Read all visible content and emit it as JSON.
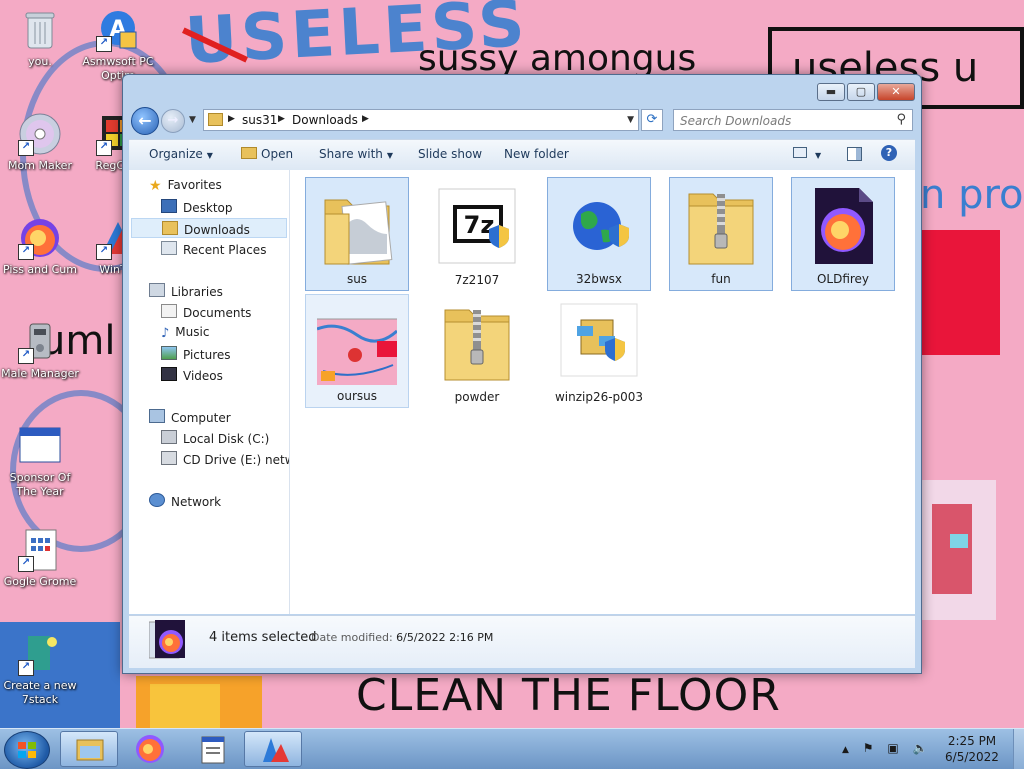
{
  "desktop": {
    "wallpaper_texts": {
      "useless_blue": "USELESS",
      "sussy": "sussy amongus",
      "useless_box": "useless u",
      "pro": "n pro",
      "clean": "CLEAN THE FLOOR",
      "umlo": "uml"
    },
    "icons": [
      {
        "label": "you.",
        "icon": "recycle-bin-icon"
      },
      {
        "label": "Asmwsoft PC Optim",
        "icon": "asmwsoft-icon"
      },
      {
        "label": "Mom Maker",
        "icon": "cd-disc-icon"
      },
      {
        "label": "RegClea",
        "icon": "regclean-icon"
      },
      {
        "label": "Piss and Cum",
        "icon": "firefox-icon"
      },
      {
        "label": "WinThi",
        "icon": "winthing-icon"
      },
      {
        "label": "Male Manager",
        "icon": "manager-icon"
      },
      {
        "label": "Sponsor Of The Year",
        "icon": "window-app-icon"
      },
      {
        "label": "Gogle Grome",
        "icon": "calculator-doc-icon"
      },
      {
        "label": "Create a new 7stack",
        "icon": "7stack-icon"
      }
    ]
  },
  "window": {
    "title": "",
    "buttons": {
      "minimize": "▬",
      "maximize": "▢",
      "close": "✕"
    },
    "address": {
      "crumbs": [
        "sus31",
        "Downloads"
      ]
    },
    "search": {
      "placeholder": "Search Downloads"
    },
    "toolbar": {
      "organize": "Organize",
      "open": "Open",
      "share_with": "Share with",
      "slide_show": "Slide show",
      "new_folder": "New folder"
    },
    "nav": {
      "favorites": "Favorites",
      "desktop": "Desktop",
      "downloads": "Downloads",
      "recent_places": "Recent Places",
      "libraries": "Libraries",
      "documents": "Documents",
      "music": "Music",
      "pictures": "Pictures",
      "videos": "Videos",
      "computer": "Computer",
      "local_disk": "Local Disk (C:)",
      "cd_drive": "CD Drive (E:) networ",
      "network": "Network"
    },
    "files": [
      {
        "name": "sus",
        "type": "folder",
        "selected": true
      },
      {
        "name": "7z2107",
        "type": "7zip-installer",
        "selected": false
      },
      {
        "name": "32bwsx",
        "type": "globe-exe",
        "selected": true
      },
      {
        "name": "fun",
        "type": "zip-folder",
        "selected": true
      },
      {
        "name": "OLDfirey",
        "type": "firefox-file",
        "selected": true
      },
      {
        "name": "oursus",
        "type": "image-file",
        "selected": false
      },
      {
        "name": "powder",
        "type": "zip-folder",
        "selected": false
      },
      {
        "name": "winzip26-p003",
        "type": "winzip-installer",
        "selected": false
      }
    ],
    "details": {
      "selected_count": "4 items selected",
      "date_modified_label": "Date modified:",
      "date_modified_value": "6/5/2022 2:16 PM"
    }
  },
  "taskbar": {
    "clock_time": "2:25 PM",
    "clock_date": "6/5/2022",
    "tray_arrow": "▲",
    "tray_icons": [
      "flag-icon",
      "network-icon",
      "volume-icon"
    ],
    "pinned": [
      "explorer-icon",
      "firefox-icon",
      "app-window-icon",
      "setup-icon"
    ]
  },
  "colors": {
    "wallpaper_pink": "#f4aac5",
    "selection_blue": "#d7e8fa",
    "window_frame": "#bcd4ee"
  }
}
